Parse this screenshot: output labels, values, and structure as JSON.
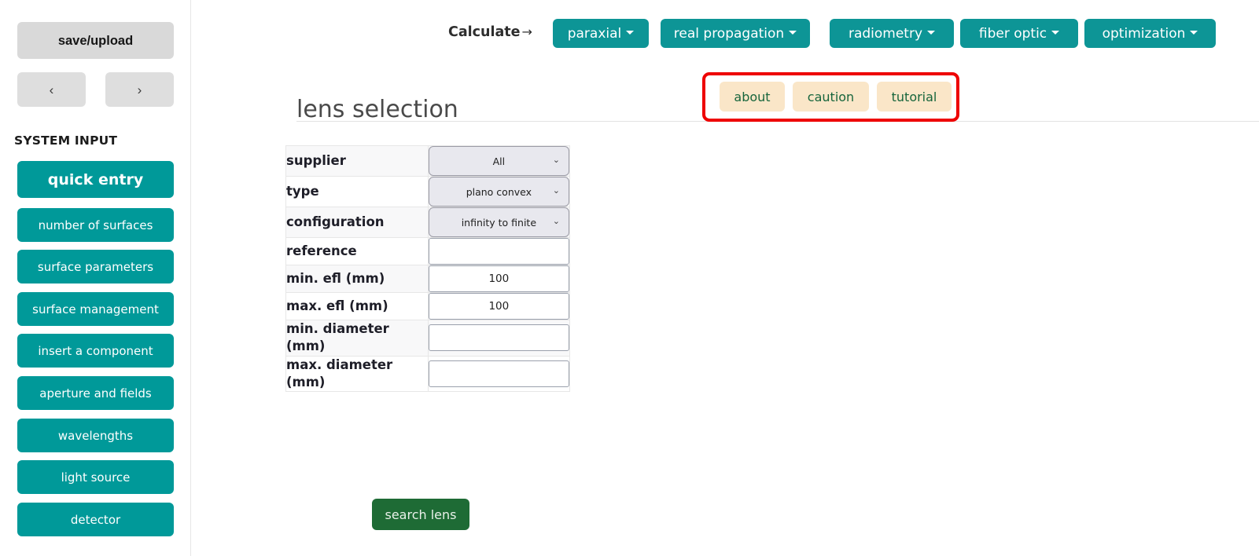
{
  "sidebar": {
    "save_upload_label": "save/upload",
    "prev_label": "‹",
    "next_label": "›",
    "section_label": "SYSTEM INPUT",
    "items": [
      {
        "label": "quick entry",
        "active": true
      },
      {
        "label": "number of surfaces",
        "active": false
      },
      {
        "label": "surface parameters",
        "active": false
      },
      {
        "label": "surface management",
        "active": false
      },
      {
        "label": "insert a component",
        "active": false
      },
      {
        "label": "aperture and fields",
        "active": false
      },
      {
        "label": "wavelengths",
        "active": false
      },
      {
        "label": "light source",
        "active": false
      },
      {
        "label": "detector",
        "active": false
      }
    ]
  },
  "topnav": {
    "calculate_label": "Calculate",
    "calculate_arrow": "→",
    "menus": [
      {
        "label": "paraxial"
      },
      {
        "label": "real propagation"
      },
      {
        "label": "radiometry"
      },
      {
        "label": "fiber optic"
      },
      {
        "label": "optimization"
      }
    ]
  },
  "main": {
    "page_title": "lens selection",
    "info_buttons": [
      {
        "label": "about"
      },
      {
        "label": "caution"
      },
      {
        "label": "tutorial"
      }
    ],
    "form_rows": [
      {
        "label": "supplier",
        "control": "select",
        "value": "All"
      },
      {
        "label": "type",
        "control": "select",
        "value": "plano convex"
      },
      {
        "label": "configuration",
        "control": "select",
        "value": "infinity to finite"
      },
      {
        "label": "reference",
        "control": "text",
        "value": ""
      },
      {
        "label": "min. efl (mm)",
        "control": "text",
        "value": "100"
      },
      {
        "label": "max. efl (mm)",
        "control": "text",
        "value": "100"
      },
      {
        "label": "min. diameter (mm)",
        "control": "text",
        "value": ""
      },
      {
        "label": "max. diameter (mm)",
        "control": "text",
        "value": ""
      }
    ],
    "search_button_label": "search lens"
  },
  "colors": {
    "teal": "#009999",
    "menu_teal": "#0d9596",
    "beige": "#fae6c8",
    "beige_text": "#17653c",
    "highlight_red": "#ee0000",
    "search_green": "#1e6b35",
    "sidebar_gray": "#d9d9d9"
  }
}
